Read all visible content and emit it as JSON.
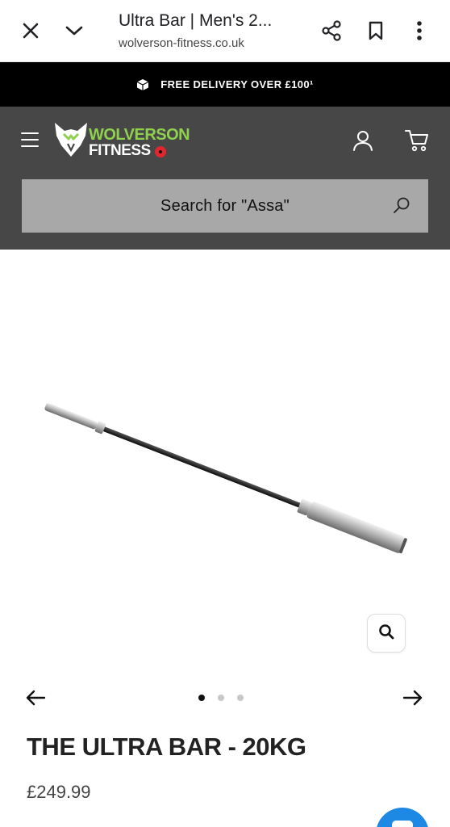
{
  "browser": {
    "title": "Ultra Bar | Men's 2...",
    "url": "wolverson-fitness.co.uk"
  },
  "promo": {
    "text": "FREE DELIVERY OVER £100¹"
  },
  "header": {
    "logo_line1": "WOLVERSON",
    "logo_line2": "FITNESS",
    "search_placeholder": "Search for \"Assa\""
  },
  "carousel": {
    "slide_count": 3,
    "active_index": 0
  },
  "product": {
    "title": "THE ULTRA BAR - 20KG",
    "price": "£249.99"
  },
  "colors": {
    "brand_green": "#8fd14f",
    "header_bg": "#474747",
    "promo_bg": "#000000",
    "search_bg": "#a8a8a8",
    "chat_blue": "#1e88e5"
  }
}
